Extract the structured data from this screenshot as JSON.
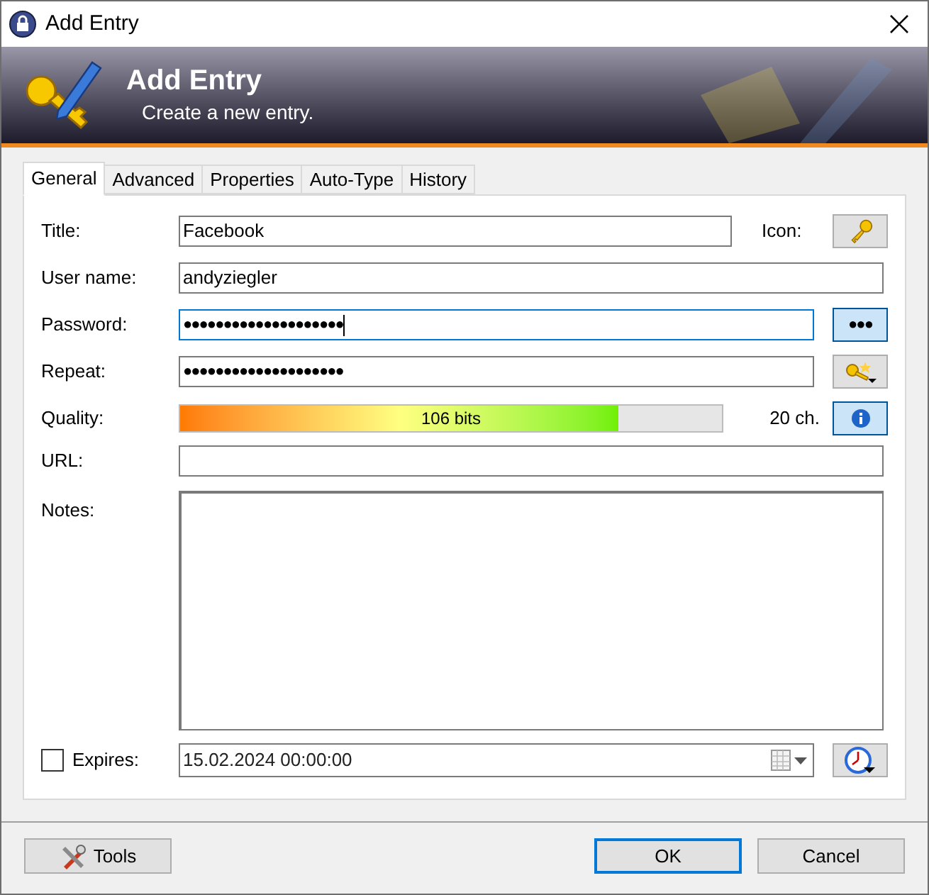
{
  "window": {
    "title": "Add Entry"
  },
  "banner": {
    "title": "Add Entry",
    "subtitle": "Create a new entry."
  },
  "tabs": [
    {
      "label": "General",
      "selected": true
    },
    {
      "label": "Advanced",
      "selected": false
    },
    {
      "label": "Properties",
      "selected": false
    },
    {
      "label": "Auto-Type",
      "selected": false
    },
    {
      "label": "History",
      "selected": false
    }
  ],
  "form": {
    "title": {
      "label": "Title:",
      "value": "Facebook"
    },
    "icon": {
      "label": "Icon:"
    },
    "username": {
      "label": "User name:",
      "value": "andyziegler"
    },
    "password": {
      "label": "Password:",
      "value": "●●●●●●●●●●●●●●●●●●●●",
      "reveal_button": "●●●",
      "focused": true
    },
    "repeat": {
      "label": "Repeat:",
      "value": "●●●●●●●●●●●●●●●●●●●●"
    },
    "quality": {
      "label": "Quality:",
      "level": 0.81,
      "reading": "106 bits",
      "length": "20 ch."
    },
    "url": {
      "label": "URL:"
    },
    "notes": {
      "label": "Notes:"
    },
    "expires": {
      "label": "Expires:",
      "checked": false,
      "value": "15.02.2024 00:00:00"
    }
  },
  "buttons": {
    "tools": "Tools",
    "ok": "OK",
    "cancel": "Cancel"
  }
}
